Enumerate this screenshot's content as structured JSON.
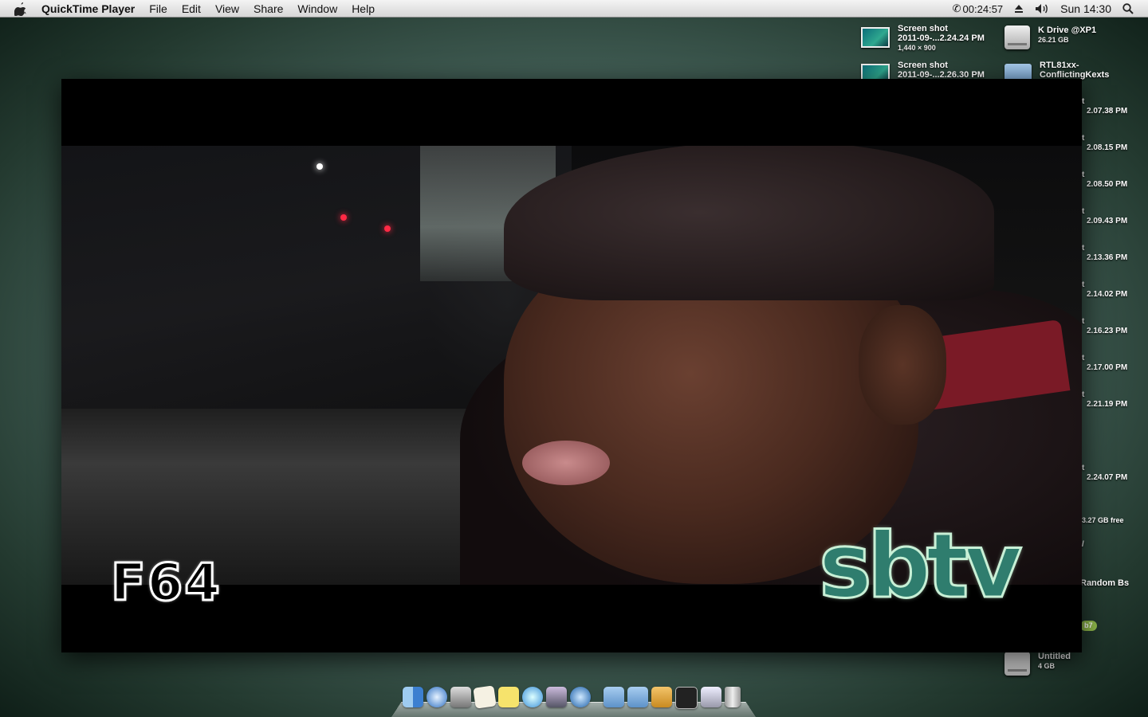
{
  "menubar": {
    "app_name": "QuickTime Player",
    "menus": [
      "File",
      "Edit",
      "View",
      "Share",
      "Window",
      "Help"
    ],
    "call_timer": "00:24:57",
    "clock": "Sun 14:30"
  },
  "desktop": {
    "items": [
      {
        "title_line1": "Screen shot",
        "title_line2": "2011-09-...2.24.24 PM",
        "subtitle": "1,440 × 900"
      },
      {
        "title_line1": "K Drive @XP1",
        "title_line2": "",
        "subtitle": "26.21 GB"
      },
      {
        "title_line1": "Screen shot",
        "title_line2": "2011-09-...2.26.30 PM",
        "subtitle": ""
      },
      {
        "title_line1": "RTL81xx-",
        "title_line2": "ConflictingKexts",
        "subtitle": ""
      },
      {
        "title_line1": "Untitled",
        "title_line2": "",
        "subtitle": "4 GB"
      }
    ],
    "peek_labels": [
      "t",
      "2.07.38 PM",
      "t",
      "2.08.15 PM",
      "t",
      "2.08.50 PM",
      "t",
      "2.09.43 PM",
      "t",
      "2.13.36 PM",
      "t",
      "2.14.02 PM",
      "t",
      "2.16.23 PM",
      "t",
      "2.17.00 PM",
      "t",
      "2.21.19 PM",
      "t",
      "2.24.07 PM",
      "3.27 GB free",
      "/",
      "Random Bs"
    ],
    "badge": "b7"
  },
  "video": {
    "overlay_left": "F64",
    "overlay_right": "sbtv"
  },
  "dock": {
    "icons": [
      "finder-icon",
      "safari-icon",
      "preview-icon",
      "textedit-icon",
      "stickies-icon",
      "itunes-icon",
      "photo-icon",
      "quicktime-icon",
      "applications-folder-icon",
      "documents-folder-icon",
      "downloads-stack-icon",
      "terminal-icon",
      "window-icon",
      "trash-icon"
    ]
  }
}
